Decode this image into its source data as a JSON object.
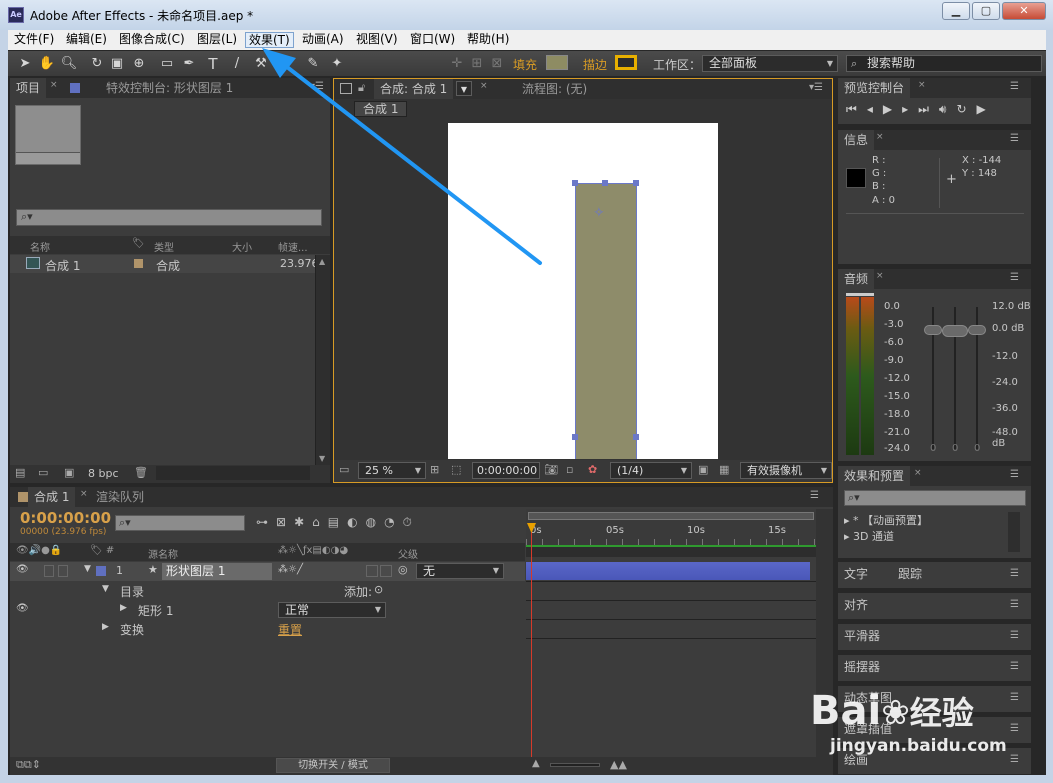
{
  "window": {
    "app_icon": "Ae",
    "title": "Adobe After Effects - 未命名项目.aep *",
    "controls": [
      "▁",
      "▢",
      "✕"
    ]
  },
  "menu": [
    "文件(F)",
    "编辑(E)",
    "图像合成(C)",
    "图层(L)",
    "效果(T)",
    "动画(A)",
    "视图(V)",
    "窗口(W)",
    "帮助(H)"
  ],
  "toolbar": {
    "fill_label": "填充",
    "stroke_label": "描边",
    "workspace_label": "工作区：",
    "workspace_value": "全部面板",
    "search_help": "搜索帮助",
    "fill_color": "#8e8c63",
    "stroke_color": "#e8b000"
  },
  "project_panel": {
    "tab_project": "项目",
    "tab_effects": "特效控制台: 形状图层 1",
    "columns": [
      "名称",
      "类型",
      "大小",
      "帧速..."
    ],
    "items": [
      {
        "name": "合成 1",
        "type": "合成",
        "fps": "23.976"
      }
    ],
    "bpc": "8 bpc"
  },
  "comp_panel": {
    "tab": "合成: 合成 1",
    "flowchart": "流程图: (无)",
    "breadcrumb": "合成 1",
    "zoom": "25 %",
    "timecode": "0:00:00:00",
    "resolution": "(1/4)",
    "camera": "有效摄像机",
    "layer_color": "#8e8c6a"
  },
  "preview": {
    "tab": "预览控制台"
  },
  "info": {
    "tab": "信息",
    "r": "R :",
    "g": "G :",
    "b": "B :",
    "a": "A : 0",
    "x": "X : -144",
    "y": "Y : 148"
  },
  "audio": {
    "tab": "音频",
    "left_scale": [
      "0.0",
      "-3.0",
      "-6.0",
      "-9.0",
      "-12.0",
      "-15.0",
      "-18.0",
      "-21.0",
      "-24.0"
    ],
    "right_scale": [
      "12.0 dB",
      "0.0 dB",
      "-12.0",
      "-24.0",
      "-36.0",
      "-48.0 dB"
    ],
    "zeros": [
      "0",
      "0",
      "0"
    ]
  },
  "effects_presets": {
    "tab": "效果和预置",
    "items": [
      "* 【动画预置】",
      "3D 通道"
    ]
  },
  "side_tabs": {
    "text": "文字",
    "tracking": "跟踪",
    "align": "对齐",
    "smoother": "平滑器",
    "wiggler": "摇摆器",
    "motion_sketch": "动态草图",
    "mask_interp": "遮罩插值",
    "brush": "绘画"
  },
  "timeline": {
    "tab": "合成 1",
    "render_tab": "渲染队列",
    "timecode": "0:00:00:00",
    "fps": "00000 (23.976 fps)",
    "col_source": "源名称",
    "col_parent": "父级",
    "ruler": [
      "0s",
      "05s",
      "10s",
      "15s"
    ],
    "layer": {
      "index": "1",
      "name": "形状图层 1",
      "parent": "无"
    },
    "contents": "目录",
    "add": "添加:",
    "rect": "矩形 1",
    "blend": "正常",
    "transform": "变换",
    "reset": "重置",
    "footer": "切换开关 / 模式"
  },
  "watermark": {
    "brand": "Bai",
    "brand2": "经验",
    "url": "jingyan.baidu.com"
  }
}
